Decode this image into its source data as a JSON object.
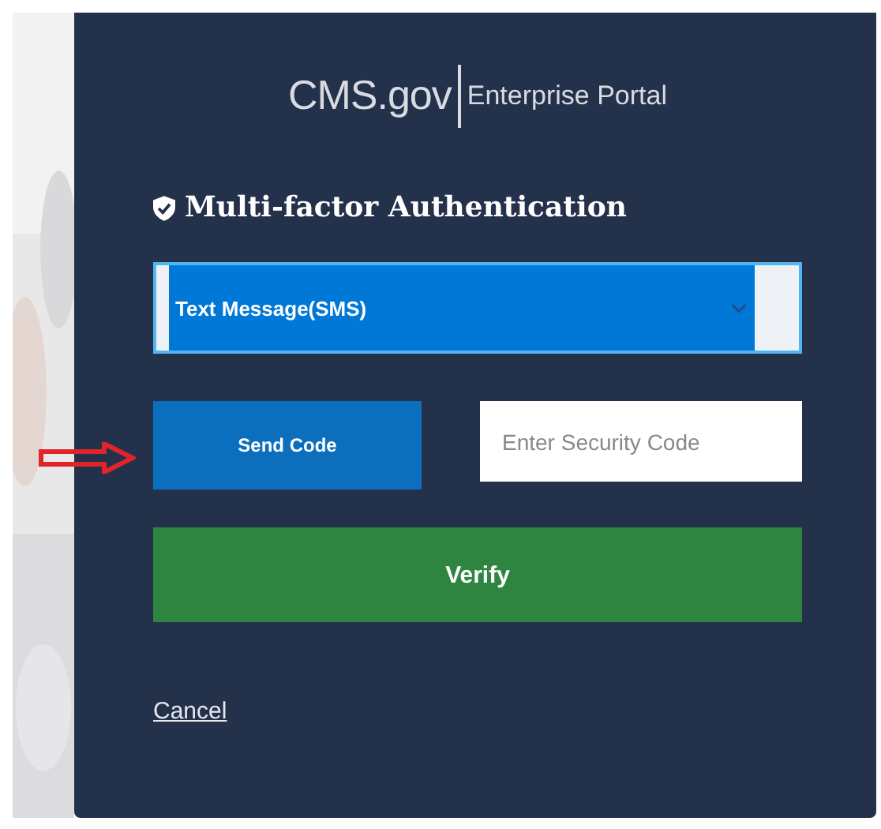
{
  "logo": {
    "brand": "CMS.gov",
    "subtitle": "Enterprise Portal"
  },
  "heading": "Multi-factor Authentication",
  "method_dropdown": {
    "value": "Text Message(SMS)"
  },
  "send_button": "Send Code",
  "code_field": {
    "placeholder": "Enter Security Code"
  },
  "verify_button": "Verify",
  "cancel_link": "Cancel"
}
